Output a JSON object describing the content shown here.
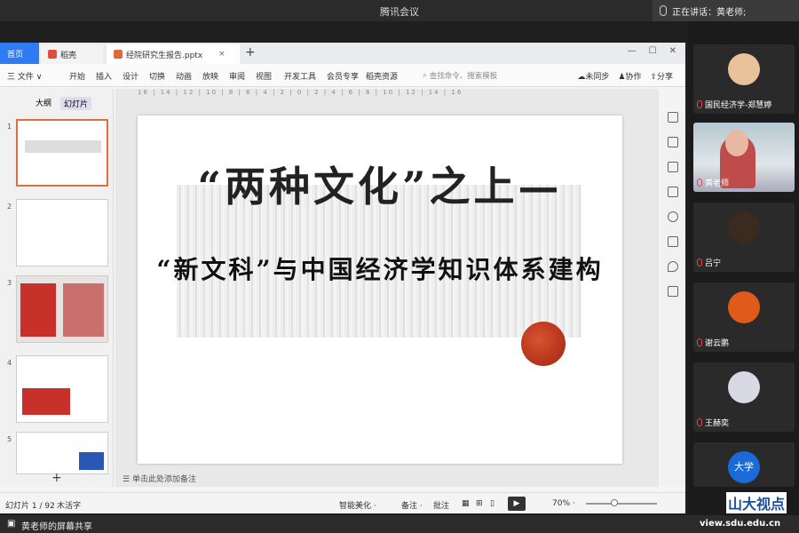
{
  "app_title": "腾讯会议",
  "speaking": "正在讲话：黄老师;",
  "tabs": {
    "home": "首页",
    "dk": "稻壳",
    "doc": "经院研究生报告.pptx"
  },
  "toolbar": {
    "file": "三 文件 ∨",
    "menus": [
      "开始",
      "插入",
      "设计",
      "切换",
      "动画",
      "放映",
      "审阅",
      "视图",
      "开发工具",
      "会员专享",
      "稻壳资源"
    ],
    "search": "查找命令、搜索模板",
    "sync": "未同步",
    "collab": "协作",
    "share": "分享"
  },
  "left_pane": {
    "outline": "大纲",
    "slides": "幻灯片",
    "thumb_nums": [
      "1",
      "2",
      "3",
      "4",
      "5"
    ]
  },
  "ruler": "16 | 14 | 12 | 10 | 8 | 6 | 4 | 2 | 0 | 2 | 4 | 6 | 8 | 10 | 12 | 14 | 16",
  "slide": {
    "title": "“两种文化”之上—",
    "subtitle": "“新文科”与中国经济学知识体系建构"
  },
  "note_placeholder": "单击此处添加备注",
  "status": {
    "slide_count": "幻灯片 1 / 92",
    "font": "木活字",
    "beautify": "智能美化 ·",
    "notes": "备注 ·",
    "comment": "批注",
    "zoom": "70% ·"
  },
  "participants": [
    {
      "name": "国民经济学-郑慧婷",
      "avatar_color": "#e8c29a"
    },
    {
      "name": "黄老师",
      "avatar_color": "#c04b4b"
    },
    {
      "name": "吕宁",
      "avatar_color": "#3a2a20"
    },
    {
      "name": "谢云鹏",
      "avatar_color": "#e05a1a"
    },
    {
      "name": "王赫奕",
      "avatar_color": "#d9d9e6"
    },
    {
      "name": "大学",
      "avatar_color": "#1a6ad8"
    }
  ],
  "screen_share": "黄老师的屏幕共享",
  "watermark": {
    "title": "山大视点",
    "url": "view.sdu.edu.cn"
  }
}
